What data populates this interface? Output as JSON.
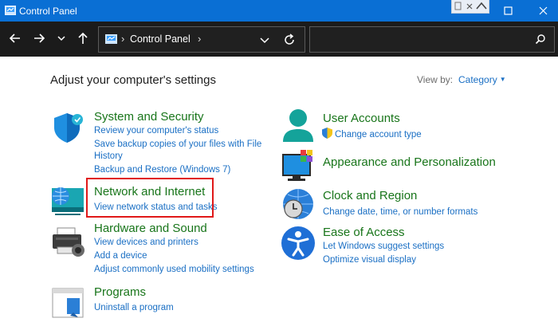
{
  "window": {
    "title": "Control Panel"
  },
  "address_bar": {
    "breadcrumb": "Control Panel",
    "separator": "›"
  },
  "search": {
    "placeholder": ""
  },
  "main": {
    "heading": "Adjust your computer's settings",
    "view_by_label": "View by:",
    "view_by_value": "Category"
  },
  "categories_left": [
    {
      "title": "System and Security",
      "icon": "shield-icon",
      "links": [
        "Review your computer's status",
        "Save backup copies of your files with File",
        "History",
        "Backup and Restore (Windows 7)"
      ]
    },
    {
      "title": "Network and Internet",
      "icon": "network-globe-icon",
      "links": [
        "View network status and tasks"
      ],
      "highlighted": true
    },
    {
      "title": "Hardware and Sound",
      "icon": "printer-icon",
      "links": [
        "View devices and printers",
        "Add a device",
        "Adjust commonly used mobility settings"
      ]
    },
    {
      "title": "Programs",
      "icon": "programs-icon",
      "links": [
        "Uninstall a program"
      ]
    }
  ],
  "categories_right": [
    {
      "title": "User Accounts",
      "icon": "user-icon",
      "links": [
        "Change account type"
      ]
    },
    {
      "title": "Appearance and Personalization",
      "icon": "monitor-palette-icon",
      "links": []
    },
    {
      "title": "Clock and Region",
      "icon": "clock-globe-icon",
      "links": [
        "Change date, time, or number formats"
      ]
    },
    {
      "title": "Ease of Access",
      "icon": "accessibility-icon",
      "links": [
        "Let Windows suggest settings",
        "Optimize visual display"
      ]
    }
  ],
  "colors": {
    "titlebar": "#0a6fd4",
    "category_title": "#18751a",
    "link": "#1a6fc4",
    "highlight_box": "#e01818"
  }
}
